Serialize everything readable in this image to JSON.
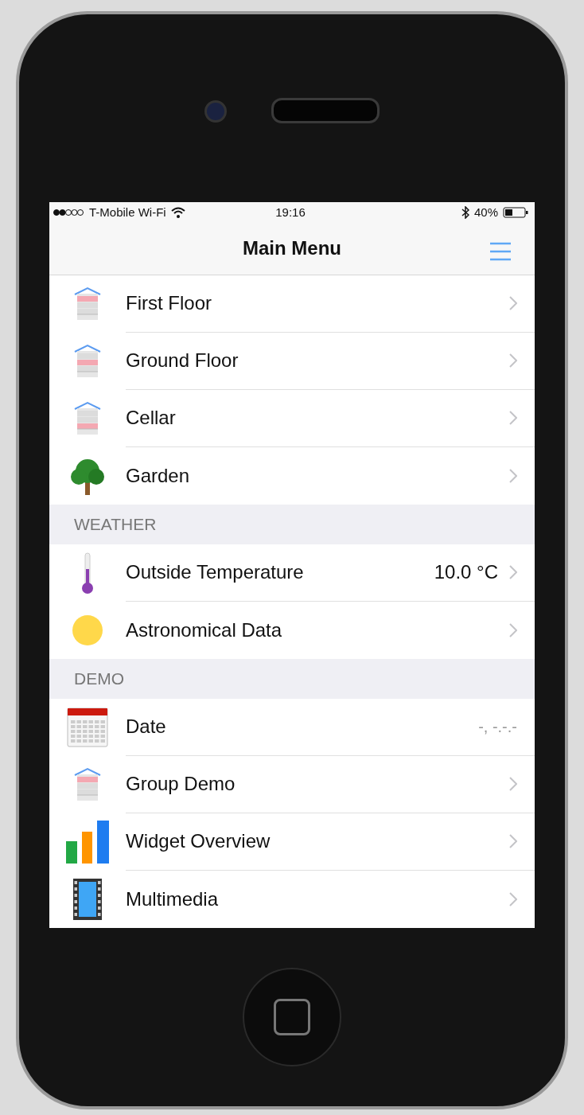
{
  "status_bar": {
    "carrier": "T-Mobile Wi-Fi",
    "time": "19:16",
    "battery": "40%"
  },
  "nav_bar": {
    "title": "Main Menu"
  },
  "sections": [
    {
      "items": [
        {
          "kind": "floor-top",
          "label": "First Floor",
          "chevron": true
        },
        {
          "kind": "floor-middle",
          "label": "Ground Floor",
          "chevron": true
        },
        {
          "kind": "floor-bottom",
          "label": "Cellar",
          "chevron": true
        },
        {
          "kind": "tree",
          "label": "Garden",
          "chevron": true
        }
      ]
    },
    {
      "header": "WEATHER",
      "items": [
        {
          "kind": "thermometer",
          "label": "Outside Temperature",
          "value": "10.0 °C",
          "chevron": true
        },
        {
          "kind": "sun",
          "label": "Astronomical Data",
          "chevron": true
        }
      ]
    },
    {
      "header": "DEMO",
      "items": [
        {
          "kind": "calendar",
          "label": "Date",
          "value": "-, -.-.-",
          "chevron": false
        },
        {
          "kind": "floor-top",
          "label": "Group Demo",
          "chevron": true
        },
        {
          "kind": "bar-chart",
          "label": "Widget Overview",
          "chevron": true
        },
        {
          "kind": "film",
          "label": "Multimedia",
          "chevron": true
        }
      ]
    }
  ]
}
